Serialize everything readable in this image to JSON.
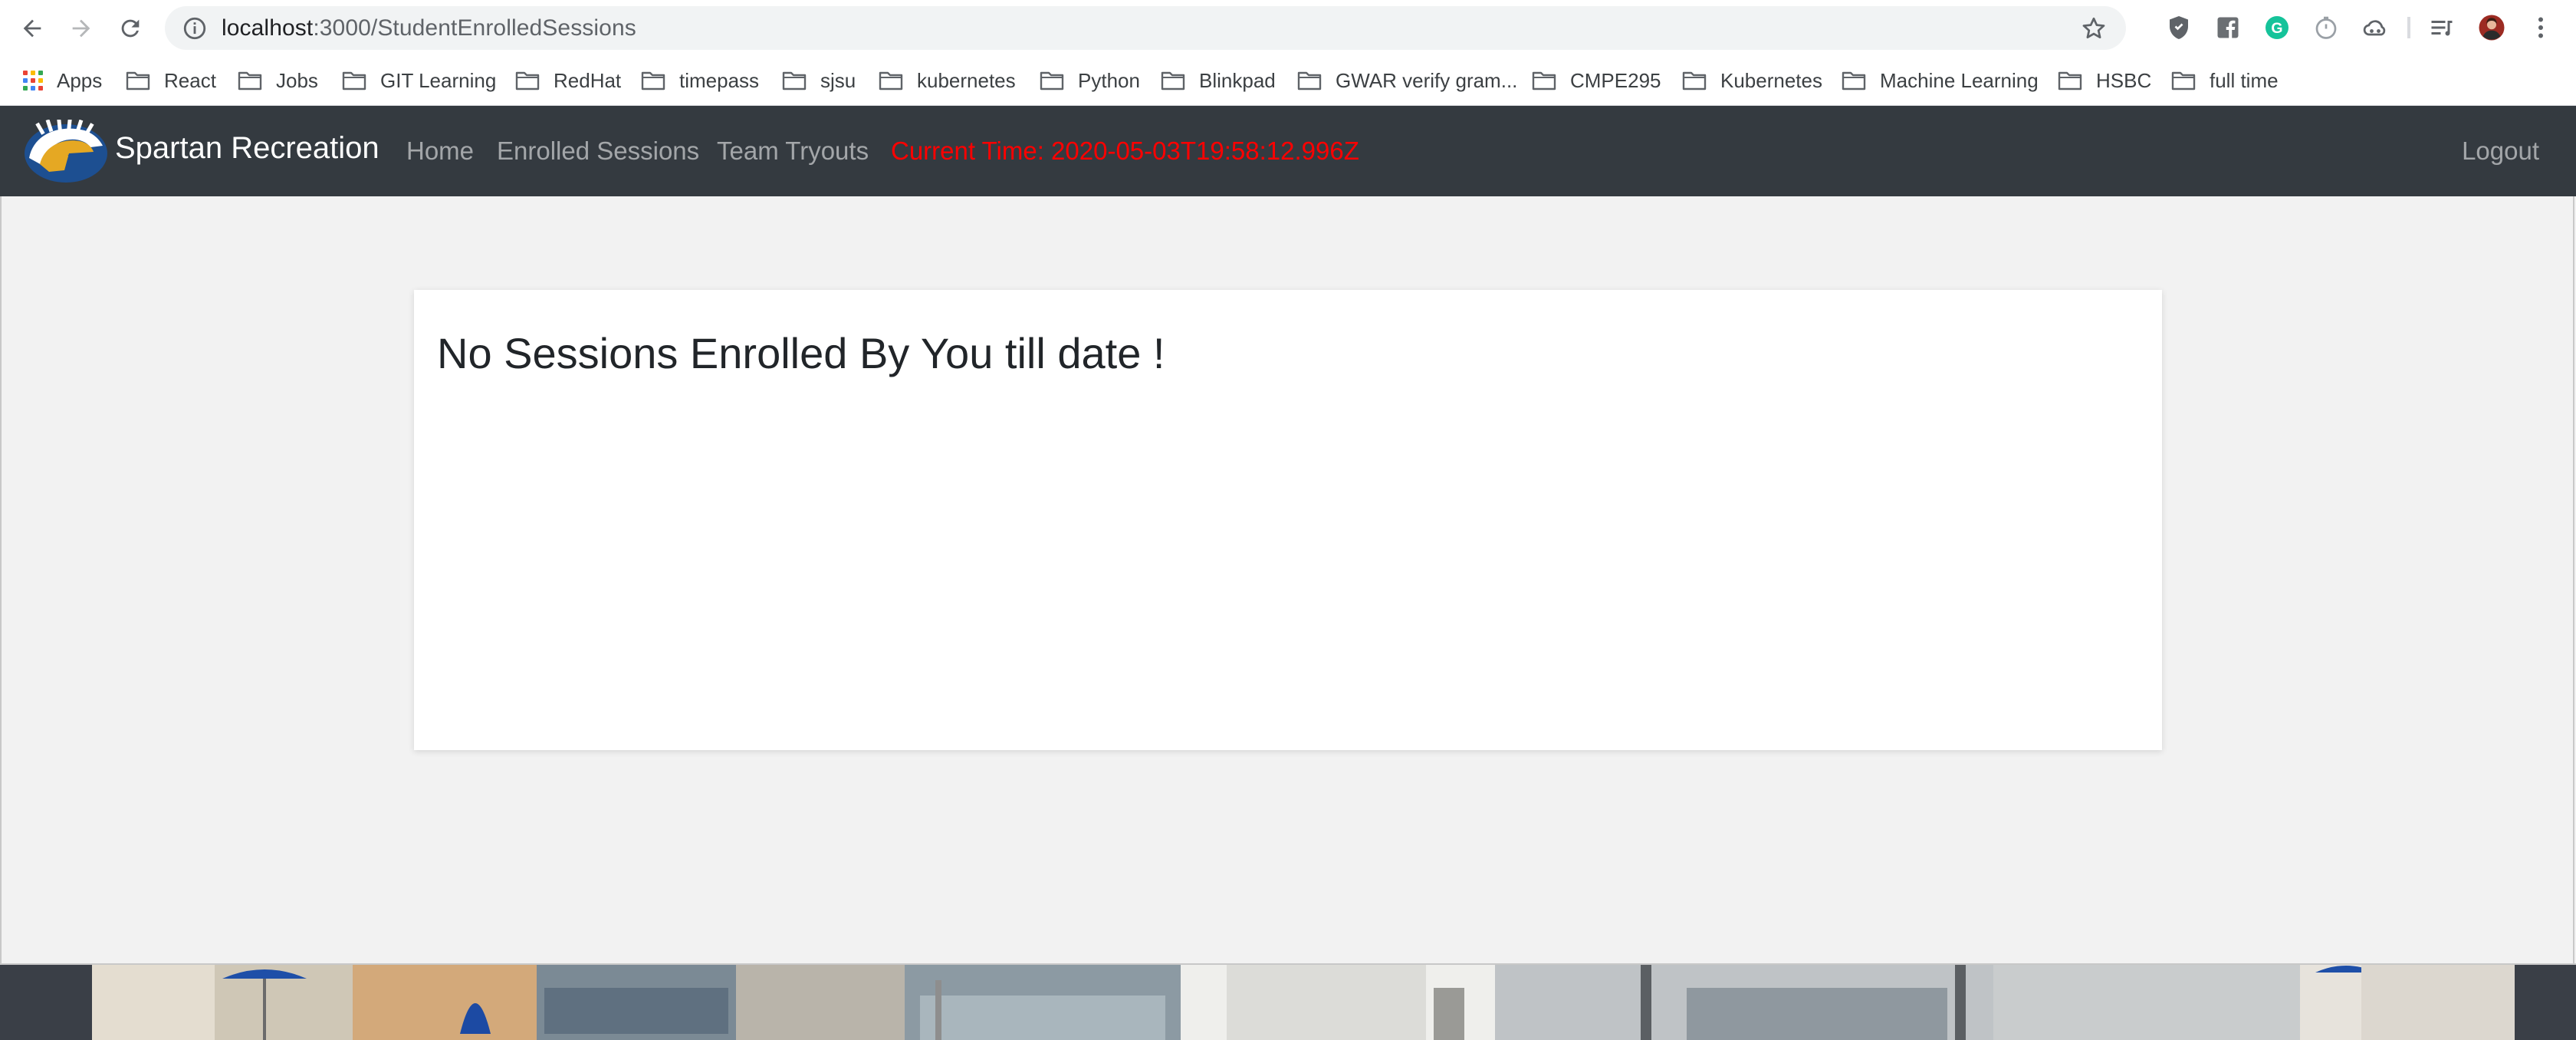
{
  "browser": {
    "url_host": "localhost",
    "url_path": ":3000/StudentEnrolledSessions",
    "bookmarks": [
      {
        "label": "Apps",
        "type": "apps"
      },
      {
        "label": "React",
        "type": "folder"
      },
      {
        "label": "Jobs",
        "type": "folder"
      },
      {
        "label": "GIT Learning",
        "type": "folder"
      },
      {
        "label": "RedHat",
        "type": "folder"
      },
      {
        "label": "timepass",
        "type": "folder"
      },
      {
        "label": "sjsu",
        "type": "folder"
      },
      {
        "label": "kubernetes",
        "type": "folder"
      },
      {
        "label": "Python",
        "type": "folder"
      },
      {
        "label": "Blinkpad",
        "type": "folder"
      },
      {
        "label": "GWAR verify gram...",
        "type": "folder"
      },
      {
        "label": "CMPE295",
        "type": "folder"
      },
      {
        "label": "Kubernetes",
        "type": "folder"
      },
      {
        "label": "Machine Learning",
        "type": "folder"
      },
      {
        "label": "HSBC",
        "type": "folder"
      },
      {
        "label": "full time",
        "type": "folder"
      }
    ],
    "extensions": [
      "shield-extension-icon",
      "facebook-extension-icon",
      "grammarly-extension-icon",
      "timer-extension-icon",
      "cloud-extension-icon",
      "reading-list-icon",
      "profile-avatar",
      "browser-menu-icon"
    ]
  },
  "navbar": {
    "brand": "Spartan Recreation",
    "links": [
      "Home",
      "Enrolled Sessions",
      "Team Tryouts"
    ],
    "current_time": "Current Time: 2020-05-03T19:58:12.996Z",
    "logout": "Logout",
    "colors": {
      "bg": "#343a40",
      "time": "#ff0000"
    }
  },
  "main": {
    "message": "No Sessions Enrolled By You till date !"
  }
}
